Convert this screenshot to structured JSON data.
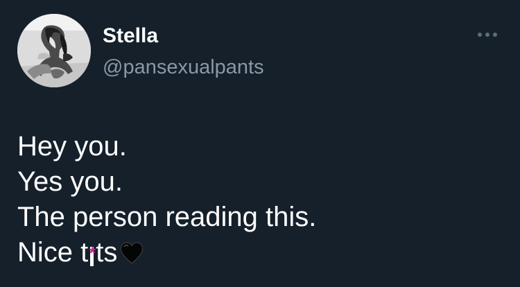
{
  "tweet": {
    "author": {
      "name": "Stella",
      "handle": "@pansexualpants",
      "avatar_icon": "profile-photo-avatar"
    },
    "more_icon": "more-horizontal-icon",
    "text_lines": {
      "line1": "Hey you.",
      "line2": "Yes you.",
      "line3": "The person reading this.",
      "line4": {
        "before": "Nice t",
        "censored_char": "*",
        "after": "ts",
        "emoji_icon": "black-heart-icon"
      }
    }
  },
  "colors": {
    "background": "#15202b",
    "text": "#ffffff",
    "secondary_text": "#8b98a5",
    "more_icon": "#5f6c79",
    "censor_star": "#c51a8a"
  }
}
